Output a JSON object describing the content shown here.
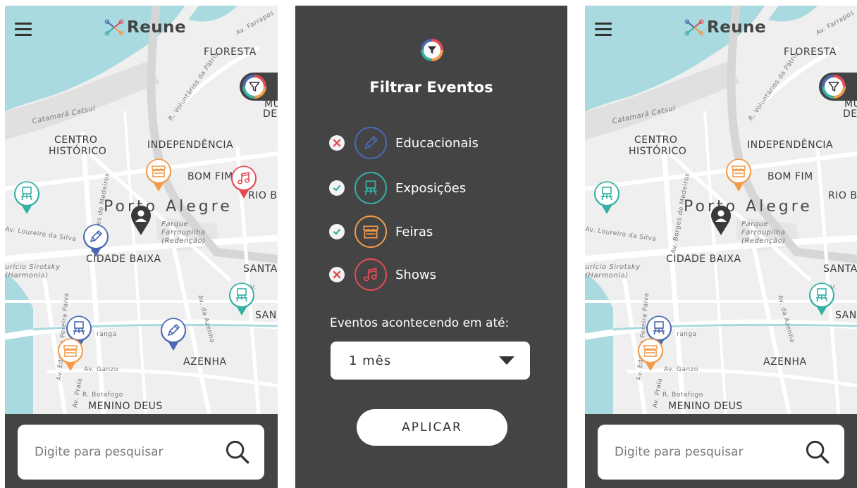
{
  "app": {
    "logo_text": "Reune",
    "search_placeholder": "Digite para pesquisar"
  },
  "map": {
    "labels": {
      "floresta": "FLORESTA",
      "centro": "CENTRO",
      "historico": "HISTÓRICO",
      "independencia": "INDEPENDÊNCIA",
      "bom_fim": "BOM FIM",
      "rio_branco": "RIO BR",
      "porto_alegre": "Porto Alegre",
      "parque1": "Parque",
      "parque2": "Farroupilha",
      "parque3": "(Redenção)",
      "cidade_baixa": "CIDADE BAIXA",
      "santa": "SANTA",
      "san": "SAN",
      "azenha": "AZENHA",
      "menino_deus": "MENINO DEUS",
      "catamara": "Catamarã Catsul",
      "auditorio1": "urício Sirotsky",
      "auditorio2": "(Harmonia)",
      "loureiro": "Av. Loureiro da Silva",
      "borges": "Av. Borges de Medeiros",
      "azenha_av": "Av. da Azenha",
      "ganzo": "Av. Ganzo",
      "botafogo": "R. Botafogo",
      "praia": "Av. Praia",
      "edvaldo": "Av. Edvaldo Pereira Paiva",
      "ipiranga": "ranga",
      "farrapos": "Av. Farrapos",
      "voluntarios": "R. Voluntários da Pátria",
      "mu": "MU",
      "de": "DE",
      "av": "AV."
    }
  },
  "filter": {
    "title": "Filtrar Eventos",
    "categories": [
      {
        "label": "Educacionais",
        "checked": false,
        "color": "#4a69b2",
        "icon": "pencil-icon"
      },
      {
        "label": "Exposições",
        "checked": true,
        "color": "#36b0a5",
        "icon": "easel-icon"
      },
      {
        "label": "Feiras",
        "checked": true,
        "color": "#f29b48",
        "icon": "market-stall-icon"
      },
      {
        "label": "Shows",
        "checked": false,
        "color": "#e34c55",
        "icon": "music-note-icon"
      }
    ],
    "period_label": "Eventos acontecendo em até:",
    "period_value": "1 mês",
    "apply_label": "APLICAR"
  }
}
